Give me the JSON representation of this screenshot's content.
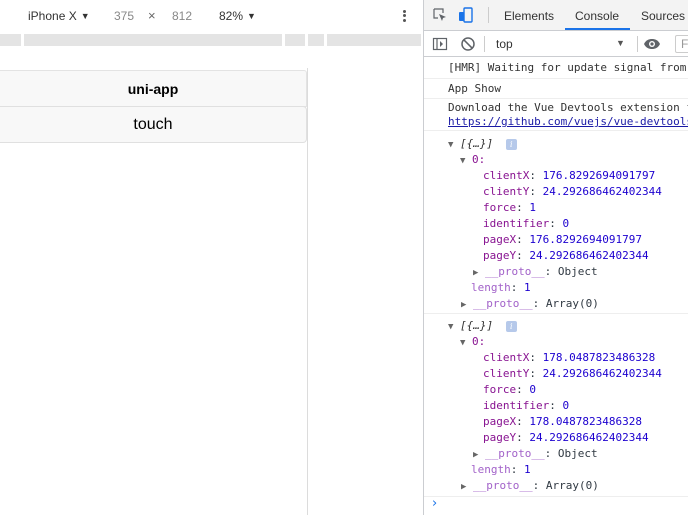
{
  "device_toolbar": {
    "device": "iPhone X",
    "width": "375",
    "times": "×",
    "height": "812",
    "zoom": "82%"
  },
  "app": {
    "nav_title": "uni-app",
    "button_label": "touch"
  },
  "devtools": {
    "tabs": [
      "Elements",
      "Console",
      "Sources"
    ],
    "active_tab": "Console",
    "context": "top",
    "filter_placeholder": "F",
    "accent": "#1a73e8"
  },
  "console": {
    "messages": [
      "[HMR] Waiting for update signal from WDS...",
      "App Show",
      "Download the Vue Devtools extension for a better development experience:"
    ],
    "link": "https://github.com/vuejs/vue-devtools",
    "logs": [
      {
        "summary": "[{…}]",
        "index": "0:",
        "props": [
          {
            "key": "clientX",
            "value": "176.8292694091797"
          },
          {
            "key": "clientY",
            "value": "24.292686462402344"
          },
          {
            "key": "force",
            "value": "1"
          },
          {
            "key": "identifier",
            "value": "0"
          },
          {
            "key": "pageX",
            "value": "176.8292694091797"
          },
          {
            "key": "pageY",
            "value": "24.292686462402344"
          }
        ],
        "proto_obj": "__proto__",
        "proto_obj_val": "Object",
        "length_key": "length",
        "length_val": "1",
        "proto_arr": "__proto__",
        "proto_arr_val": "Array(0)"
      },
      {
        "summary": "[{…}]",
        "index": "0:",
        "props": [
          {
            "key": "clientX",
            "value": "178.0487823486328"
          },
          {
            "key": "clientY",
            "value": "24.292686462402344"
          },
          {
            "key": "force",
            "value": "0"
          },
          {
            "key": "identifier",
            "value": "0"
          },
          {
            "key": "pageX",
            "value": "178.0487823486328"
          },
          {
            "key": "pageY",
            "value": "24.292686462402344"
          }
        ],
        "proto_obj": "__proto__",
        "proto_obj_val": "Object",
        "length_key": "length",
        "length_val": "1",
        "proto_arr": "__proto__",
        "proto_arr_val": "Array(0)"
      }
    ],
    "prompt": "›"
  }
}
